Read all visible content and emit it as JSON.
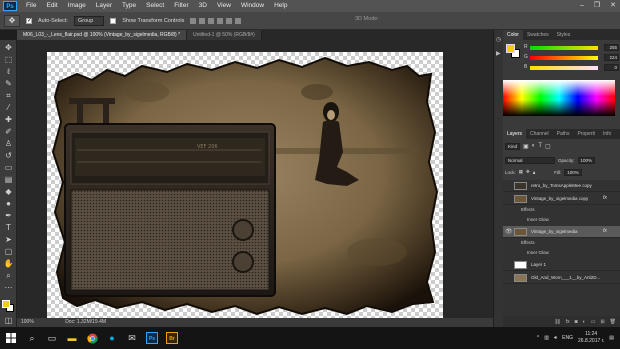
{
  "app": {
    "logo": "Ps"
  },
  "menu": [
    "File",
    "Edit",
    "Image",
    "Layer",
    "Type",
    "Select",
    "Filter",
    "3D",
    "View",
    "Window",
    "Help"
  ],
  "window_controls": [
    "–",
    "❐",
    "✕"
  ],
  "options": {
    "auto_select_label": "Auto-Select:",
    "auto_select_checked": true,
    "auto_select_target": "Group",
    "show_transform_label": "Show Transform Controls",
    "mode_3d_label": "3D Mode:"
  },
  "tabs": [
    {
      "label": "M06_L03_-_Lens_flair.psd @ 100% (Vintage_by_sigelmedia, RGB/8) *",
      "active": true
    },
    {
      "label": "Untitled-1 @ 50% (RGB/8#)",
      "active": false
    }
  ],
  "statusbar": {
    "zoom": "100%",
    "doc": "Doc: 1.32M/19.4M"
  },
  "color_panel": {
    "tabs": [
      "Color",
      "Swatches",
      "Styles"
    ],
    "fg_color": "#f2d000",
    "bg_color": "#ffffff",
    "sliders": [
      {
        "label": "R",
        "value": "255"
      },
      {
        "label": "G",
        "value": "224"
      },
      {
        "label": "B",
        "value": "0"
      }
    ]
  },
  "layers_panel": {
    "tabs": [
      "Layers",
      "Channel",
      "Paths",
      "Properti",
      "Info"
    ],
    "filter_kind": "Kind",
    "blend_mode": "Normal",
    "opacity_label": "Opacity:",
    "opacity_value": "100%",
    "lock_label": "Lock:",
    "fill_label": "Fill:",
    "fill_value": "100%",
    "layers": [
      {
        "name": "retro_by_TomsAppleMee copy",
        "visible": false,
        "active": false,
        "fx": false,
        "thumb": "#3a342a"
      },
      {
        "name": "Vintage_by_sigelmedia copy",
        "visible": false,
        "active": false,
        "fx": true,
        "thumb": "#6b5638"
      },
      {
        "name": "Vintage_by_sigelmedia",
        "visible": true,
        "active": true,
        "fx": true,
        "thumb": "#6b5638"
      },
      {
        "name": "Layer 1",
        "visible": false,
        "active": false,
        "fx": false,
        "thumb": "#ffffff"
      },
      {
        "name": "Old_And_Worn___1__by_Arti2D...",
        "visible": false,
        "active": false,
        "fx": false,
        "thumb": "#8a7456"
      }
    ],
    "effects_label": "Effects",
    "inner_glow_label": "Inner Glow"
  },
  "taskbar": {
    "search_icon": "search-icon",
    "lang": "ENG",
    "time": "11:24",
    "date": "26.8.2017 г."
  },
  "photo": {
    "radio_brand": "VEF 206"
  }
}
